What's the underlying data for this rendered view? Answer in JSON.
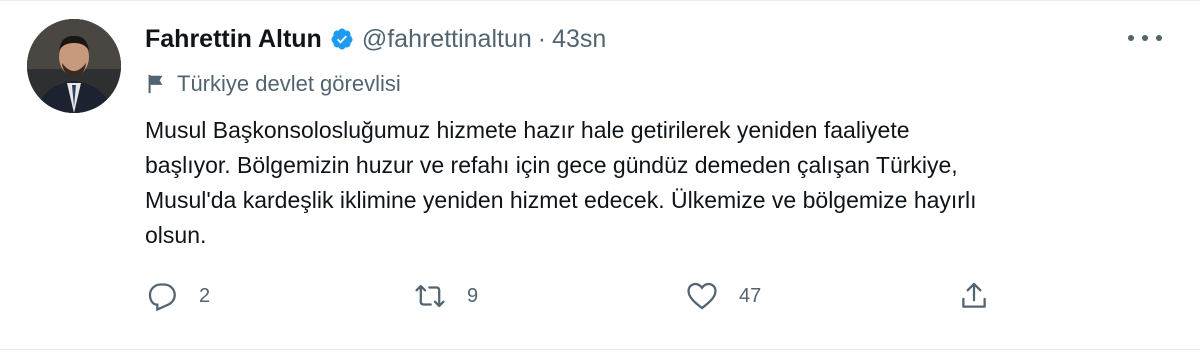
{
  "author": {
    "display_name": "Fahrettin Altun",
    "handle": "@fahrettinaltun",
    "separator": "·",
    "time": "43sn",
    "verified": true,
    "avatar": "profile-photo"
  },
  "label": {
    "icon": "flag-icon",
    "text": "Türkiye devlet görevlisi"
  },
  "tweet": {
    "lines": [
      "Musul Başkonsolosluğumuz hizmete hazır hale getirilerek yeniden faaliyete",
      "başlıyor. Bölgemizin huzur ve refahı için gece gündüz demeden çalışan Türkiye,",
      "Musul'da kardeşlik iklimine yeniden hizmet edecek. Ülkemize ve bölgemize hayırlı",
      "olsun."
    ]
  },
  "actions": {
    "reply_count": "2",
    "retweet_count": "9",
    "like_count": "47",
    "share_count": ""
  },
  "colors": {
    "text_primary": "#0f1419",
    "text_secondary": "#536471",
    "verified_blue": "#1d9bf0",
    "border": "#e6ecf0"
  }
}
